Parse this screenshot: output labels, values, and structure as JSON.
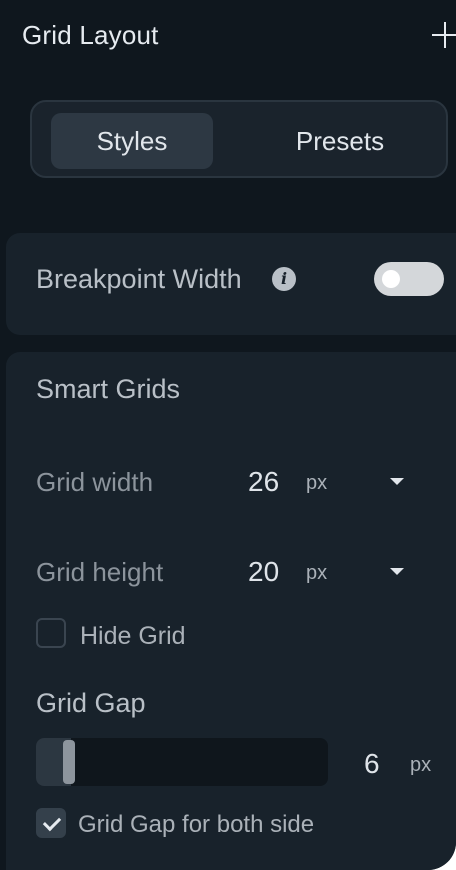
{
  "panel": {
    "title": "Grid Layout"
  },
  "tabs": [
    {
      "label": "Styles",
      "active": true
    },
    {
      "label": "Presets",
      "active": false
    }
  ],
  "breakpoint": {
    "label": "Breakpoint Width",
    "info_icon_glyph": "i",
    "toggle_on": false
  },
  "smart_grids": {
    "title": "Smart Grids",
    "grid_width": {
      "label": "Grid width",
      "value": "26",
      "unit": "px"
    },
    "grid_height": {
      "label": "Grid height",
      "value": "20",
      "unit": "px"
    },
    "hide_grid": {
      "label": "Hide Grid",
      "checked": false
    },
    "grid_gap": {
      "title": "Grid Gap",
      "value": "6",
      "unit": "px",
      "slider_fraction": 0.1,
      "both_side_label": "Grid Gap for both side",
      "both_side_checked": true
    }
  },
  "colors": {
    "panel_bg": "#0f171e",
    "card_bg": "#18222b",
    "active_tab_bg": "#2d3843",
    "toggle_off": "#d4d7da"
  }
}
